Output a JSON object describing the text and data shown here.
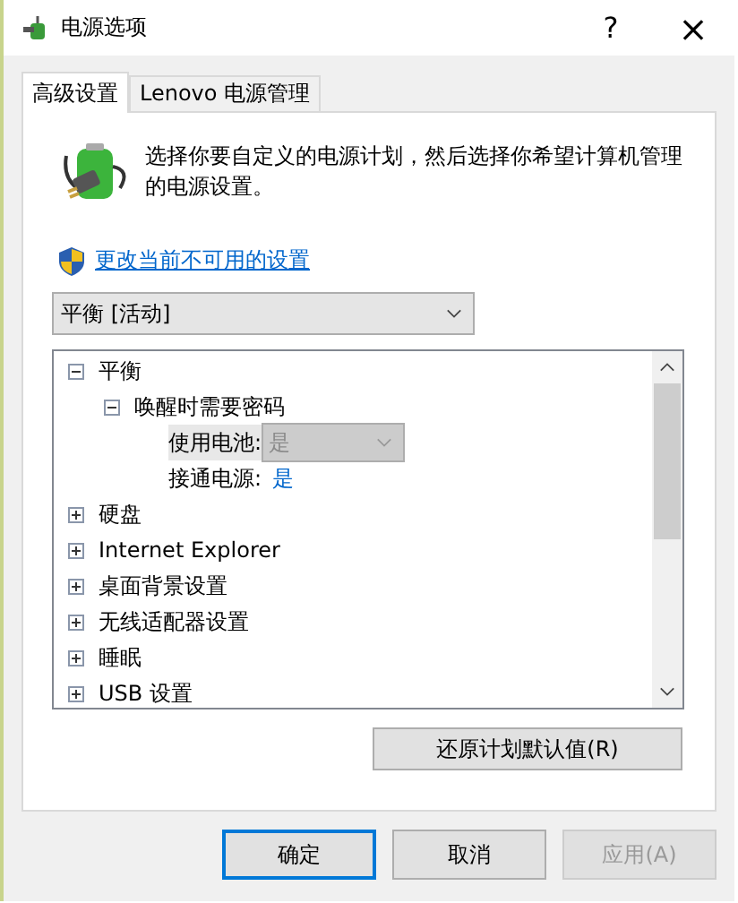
{
  "window": {
    "title": "电源选项",
    "help": "?",
    "close": "×"
  },
  "tabs": [
    {
      "label": "高级设置",
      "selected": true
    },
    {
      "label": "Lenovo 电源管理",
      "selected": false
    }
  ],
  "description": "选择你要自定义的电源计划，然后选择你希望计算机管理的电源设置。",
  "link": "更改当前不可用的设置",
  "plan_select": {
    "value": "平衡 [活动]"
  },
  "tree": [
    {
      "label": "平衡",
      "expanded": true,
      "children": [
        {
          "label": "唤醒时需要密码",
          "expanded": true,
          "children": [
            {
              "kind": "select",
              "label": "使用电池:",
              "value": "是",
              "disabled": true
            },
            {
              "kind": "link",
              "label": "接通电源:",
              "value": "是"
            }
          ]
        }
      ]
    },
    {
      "label": "硬盘",
      "expanded": false
    },
    {
      "label": "Internet Explorer",
      "expanded": false
    },
    {
      "label": "桌面背景设置",
      "expanded": false
    },
    {
      "label": "无线适配器设置",
      "expanded": false
    },
    {
      "label": "睡眠",
      "expanded": false
    },
    {
      "label": "USB 设置",
      "expanded": false
    }
  ],
  "restore_button": "还原计划默认值(R)",
  "buttons": [
    {
      "label": "确定",
      "kind": "default",
      "disabled": false
    },
    {
      "label": "取消",
      "kind": "normal",
      "disabled": false
    },
    {
      "label": "应用(A)",
      "kind": "normal",
      "disabled": true
    }
  ]
}
